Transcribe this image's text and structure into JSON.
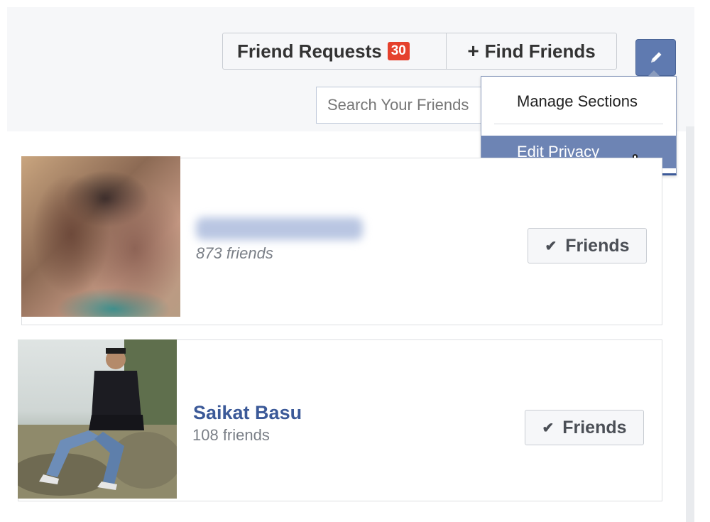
{
  "header": {
    "friend_requests_label": "Friend Requests",
    "friend_requests_count": "30",
    "find_friends_plus": "+",
    "find_friends_label": "Find Friends",
    "edit_icon": "pencil-icon"
  },
  "search": {
    "placeholder": "Search Your Friends"
  },
  "dropdown": {
    "manage_sections": "Manage Sections",
    "edit_privacy": "Edit Privacy"
  },
  "friends": [
    {
      "name": "████ ███ ███",
      "friend_count": "873 friends",
      "button_label": "Friends",
      "check_icon": "checkmark-icon"
    },
    {
      "name": "Saikat Basu",
      "friend_count": "108 friends",
      "button_label": "Friends",
      "check_icon": "checkmark-icon"
    }
  ],
  "colors": {
    "accent": "#3b5998",
    "badge": "#e5412d",
    "menu_highlight": "#6d84b4"
  }
}
